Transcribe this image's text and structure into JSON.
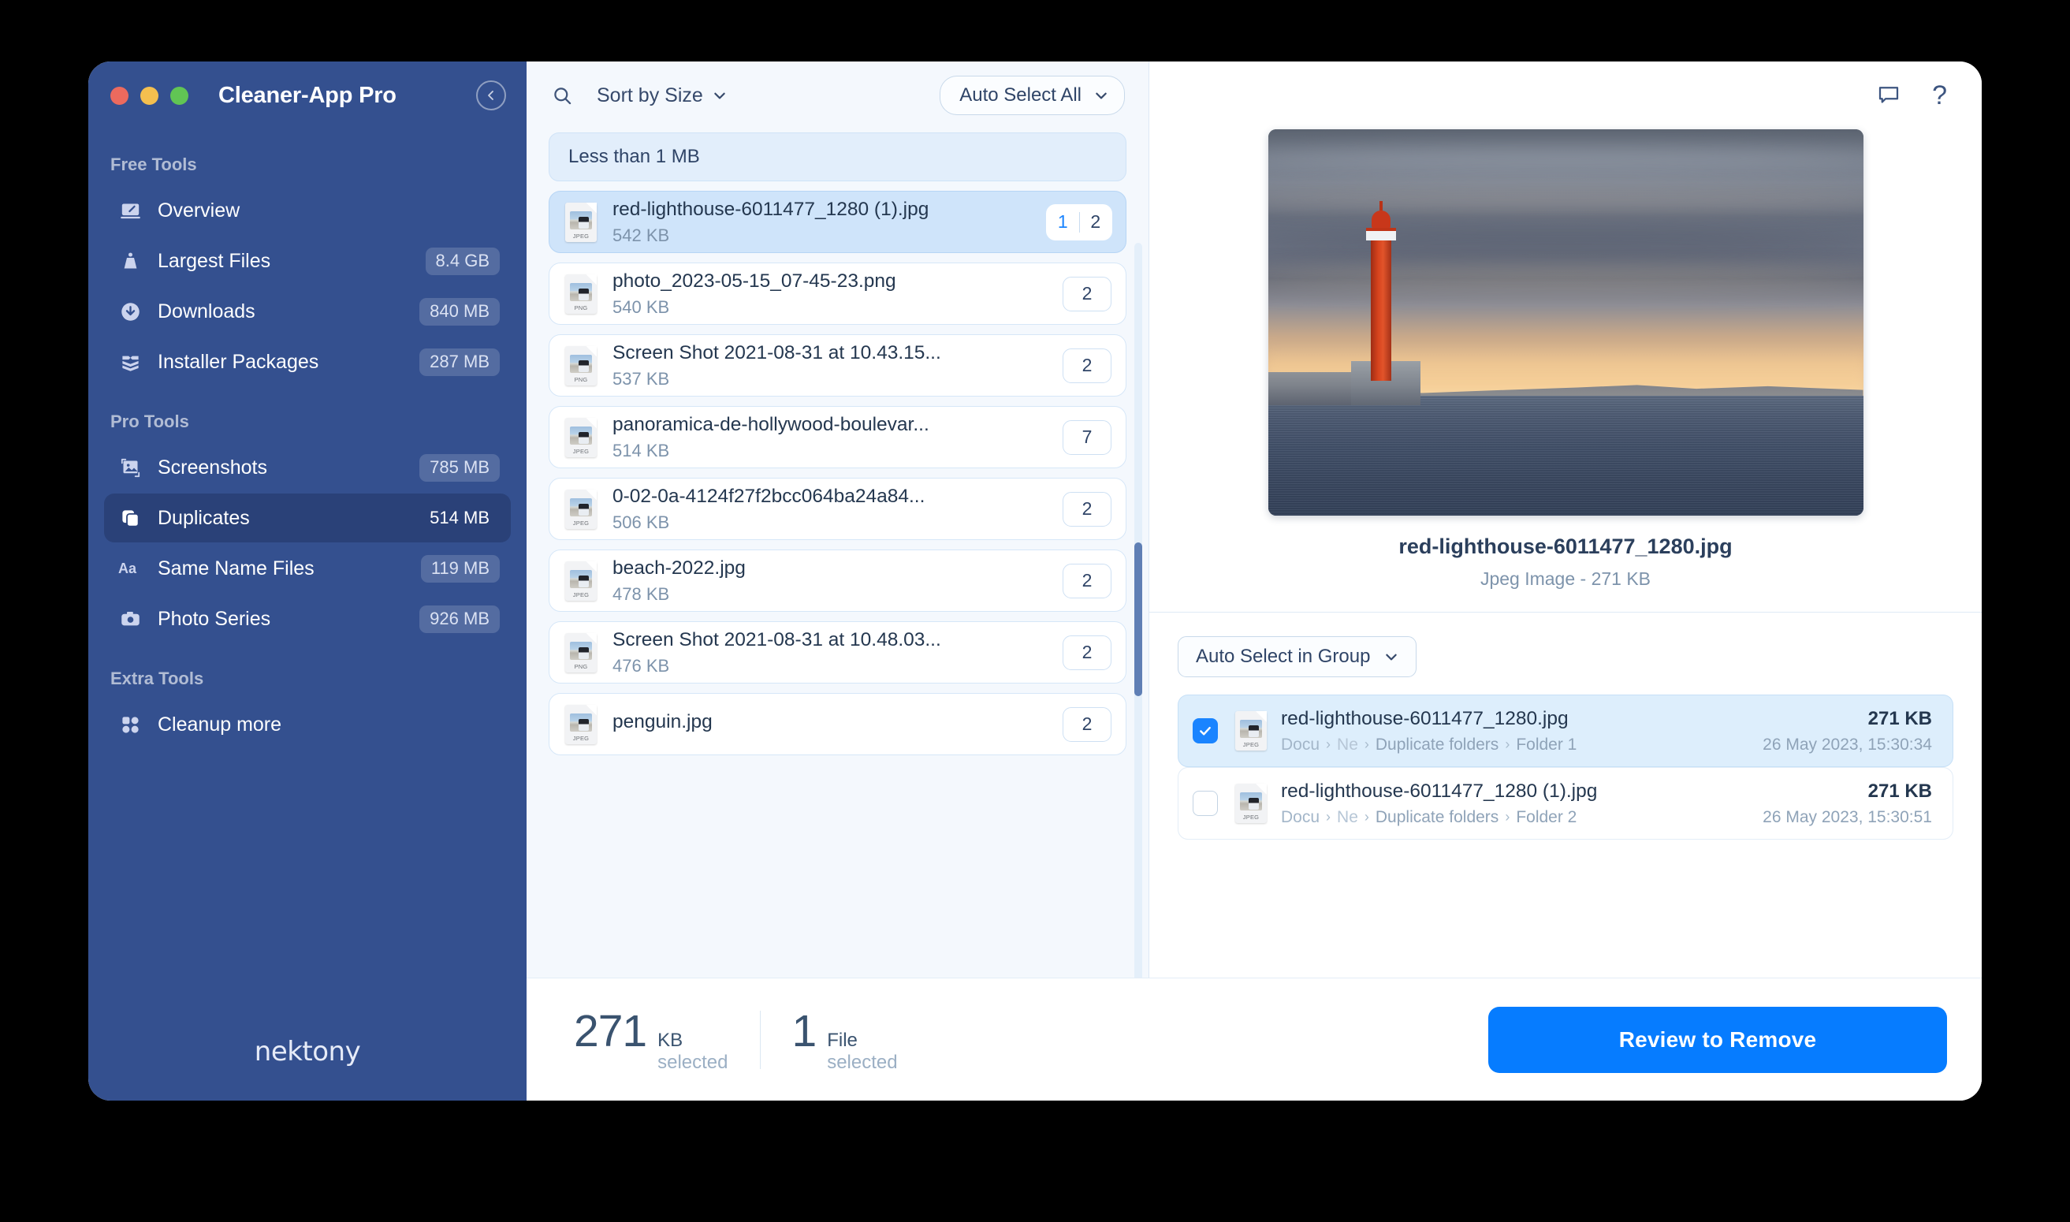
{
  "window": {
    "app_title": "Cleaner-App Pro",
    "traffic_lights": [
      "close",
      "minimize",
      "zoom"
    ],
    "collapse_icon": "chevron-left-circle-icon"
  },
  "sidebar": {
    "brand": "nektony",
    "sections": [
      {
        "label": "Free Tools",
        "items": [
          {
            "icon": "overview-icon",
            "label": "Overview",
            "badge": "",
            "active": false
          },
          {
            "icon": "weight-icon",
            "label": "Largest Files",
            "badge": "8.4 GB",
            "active": false
          },
          {
            "icon": "download-icon",
            "label": "Downloads",
            "badge": "840 MB",
            "active": false
          },
          {
            "icon": "package-icon",
            "label": "Installer Packages",
            "badge": "287 MB",
            "active": false
          }
        ]
      },
      {
        "label": "Pro Tools",
        "items": [
          {
            "icon": "image-icon",
            "label": "Screenshots",
            "badge": "785 MB",
            "active": false
          },
          {
            "icon": "duplicates-icon",
            "label": "Duplicates",
            "badge": "514 MB",
            "active": true
          },
          {
            "icon": "text-aa-icon",
            "label": "Same Name Files",
            "badge": "119 MB",
            "active": false
          },
          {
            "icon": "camera-icon",
            "label": "Photo Series",
            "badge": "926 MB",
            "active": false
          }
        ]
      },
      {
        "label": "Extra Tools",
        "items": [
          {
            "icon": "grid-icon",
            "label": "Cleanup more",
            "badge": "",
            "active": false
          }
        ]
      }
    ]
  },
  "middle": {
    "search_icon": "search-icon",
    "sort_label": "Sort by Size",
    "sort_chevron": "chevron-down-icon",
    "auto_select_all_label": "Auto Select All",
    "auto_select_all_chevron": "chevron-down-icon",
    "group_header": "Less than 1 MB",
    "files": [
      {
        "name": "red-lighthouse-6011477_1280 (1).jpg",
        "size": "542 KB",
        "type": "JPEG",
        "count": "2",
        "current": "1",
        "selected": true
      },
      {
        "name": "photo_2023-05-15_07-45-23.png",
        "size": "540 KB",
        "type": "PNG",
        "count": "2",
        "selected": false
      },
      {
        "name": "Screen Shot 2021-08-31 at 10.43.15...",
        "size": "537 KB",
        "type": "PNG",
        "count": "2",
        "selected": false
      },
      {
        "name": "panoramica-de-hollywood-boulevar...",
        "size": "514 KB",
        "type": "JPEG",
        "count": "7",
        "selected": false
      },
      {
        "name": "0-02-0a-4124f27f2bcc064ba24a84...",
        "size": "506 KB",
        "type": "JPEG",
        "count": "2",
        "selected": false
      },
      {
        "name": "beach-2022.jpg",
        "size": "478 KB",
        "type": "JPEG",
        "count": "2",
        "selected": false
      },
      {
        "name": "Screen Shot 2021-08-31 at 10.48.03...",
        "size": "476 KB",
        "type": "PNG",
        "count": "2",
        "selected": false
      },
      {
        "name": "penguin.jpg",
        "size": "",
        "type": "JPEG",
        "count": "2",
        "selected": false
      }
    ]
  },
  "right": {
    "chat_icon": "chat-bubble-icon",
    "help_icon": "question-mark-icon",
    "help_glyph": "?",
    "preview": {
      "image_alt": "red-lighthouse-photo",
      "name": "red-lighthouse-6011477_1280.jpg",
      "subtitle": "Jpeg Image - 271 KB"
    },
    "auto_select_group_label": "Auto Select in Group",
    "auto_select_group_chevron": "chevron-down-icon",
    "duplicates": [
      {
        "name": "red-lighthouse-6011477_1280.jpg",
        "type": "JPEG",
        "path": [
          "Docu",
          "Ne",
          "Duplicate folders",
          "Folder 1"
        ],
        "size": "271 KB",
        "date": "26 May 2023, 15:30:34",
        "checked": true
      },
      {
        "name": "red-lighthouse-6011477_1280 (1).jpg",
        "type": "JPEG",
        "path": [
          "Docu",
          "Ne",
          "Duplicate folders",
          "Folder 2"
        ],
        "size": "271 KB",
        "date": "26 May 2023, 15:30:51",
        "checked": false
      }
    ]
  },
  "bottom": {
    "size_number": "271",
    "size_unit": "KB",
    "size_sub": "selected",
    "file_number": "1",
    "file_unit": "File",
    "file_sub": "selected",
    "review_button": "Review to Remove"
  },
  "colors": {
    "sidebar_bg": "#34508f",
    "sidebar_active": "#2a4178",
    "accent_blue": "#067cff",
    "selection_blue": "#cfe4fa",
    "panel_bg": "#f4f8fd",
    "text_dark": "#24374f",
    "text_muted": "#7d93ab"
  }
}
